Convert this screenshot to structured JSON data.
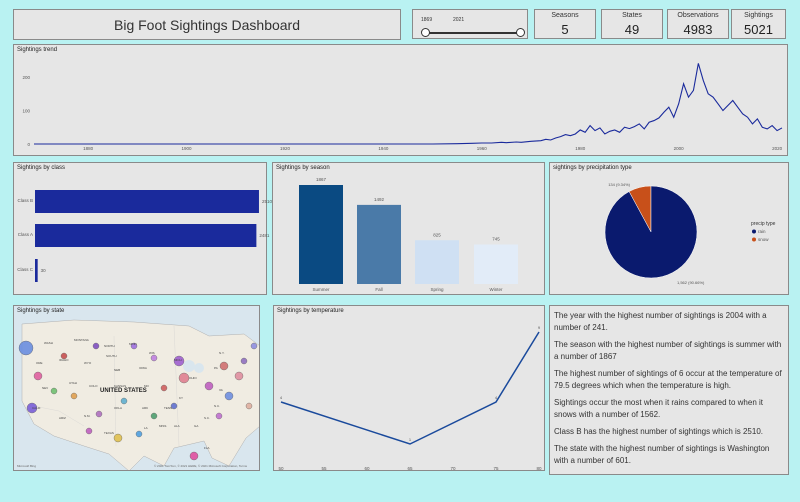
{
  "header": {
    "title": "Big Foot Sightings Dashboard"
  },
  "slider": {
    "from": "1869",
    "to": "2021"
  },
  "kpis": [
    {
      "label": "Seasons",
      "value": "5"
    },
    {
      "label": "States",
      "value": "49"
    },
    {
      "label": "Observations",
      "value": "4983"
    },
    {
      "label": "Sightings",
      "value": "5021"
    }
  ],
  "panels": {
    "trend": "Sightings trend",
    "class": "Sightings by class",
    "season": "Sightings by season",
    "precip": "sightings by precipitation type",
    "state": "Sightings by state",
    "temp": "Sightings by temperature"
  },
  "chart_data": [
    {
      "type": "line",
      "title": "Sightings trend",
      "x": [
        1869,
        1875,
        1880,
        1885,
        1890,
        1895,
        1900,
        1905,
        1910,
        1915,
        1920,
        1925,
        1930,
        1935,
        1940,
        1945,
        1950,
        1955,
        1958,
        1960,
        1962,
        1964,
        1965,
        1967,
        1968,
        1970,
        1972,
        1973,
        1974,
        1975,
        1976,
        1977,
        1978,
        1979,
        1980,
        1981,
        1982,
        1983,
        1984,
        1985,
        1986,
        1987,
        1988,
        1989,
        1990,
        1991,
        1992,
        1993,
        1994,
        1995,
        1996,
        1997,
        1998,
        1999,
        2000,
        2001,
        2002,
        2003,
        2004,
        2005,
        2006,
        2007,
        2008,
        2009,
        2010,
        2011,
        2012,
        2013,
        2014,
        2015,
        2016,
        2017,
        2018,
        2019,
        2020,
        2021
      ],
      "values": [
        0,
        0,
        0,
        0,
        0,
        0,
        0,
        0,
        0,
        0,
        0,
        0,
        0,
        0,
        0,
        0,
        0,
        1,
        2,
        3,
        3,
        5,
        4,
        6,
        5,
        8,
        10,
        14,
        12,
        18,
        22,
        28,
        25,
        30,
        42,
        35,
        55,
        40,
        48,
        30,
        38,
        42,
        35,
        50,
        46,
        52,
        60,
        45,
        65,
        70,
        78,
        95,
        110,
        80,
        120,
        180,
        140,
        160,
        241,
        190,
        150,
        140,
        120,
        100,
        115,
        130,
        110,
        90,
        80,
        60,
        75,
        50,
        45,
        55,
        40,
        48
      ],
      "xticks": [
        "1880",
        "1900",
        "1920",
        "1940",
        "1960",
        "1980",
        "2000",
        "2020"
      ],
      "yticks": [
        "0",
        "100",
        "200"
      ],
      "ylim": [
        0,
        260
      ]
    },
    {
      "type": "bar",
      "orientation": "horizontal",
      "title": "Sightings by class",
      "categories": [
        "Class B",
        "Class A",
        "Class C"
      ],
      "values": [
        2510,
        2481,
        30
      ],
      "color": "#1a2a9c"
    },
    {
      "type": "bar",
      "title": "Sightings by season",
      "categories": [
        "Summer",
        "Fall",
        "Spring",
        "Winter"
      ],
      "values": [
        1867,
        1492,
        825,
        745
      ],
      "colors": [
        "#0a4a82",
        "#4a7aa8",
        "#cfe0f3",
        "#e2ecf8"
      ]
    },
    {
      "type": "pie",
      "title": "sightings by precipitation type",
      "legend_title": "precip type",
      "categories": [
        "rain",
        "snow"
      ],
      "values": [
        1562,
        134
      ],
      "labels": [
        "1,562 (90.66%)",
        "134 (9.34%)"
      ],
      "colors": [
        "#0a1a6e",
        "#c8501a"
      ]
    },
    {
      "type": "line",
      "title": "Sightings by temperature",
      "x": [
        50,
        65,
        75,
        80
      ],
      "values": [
        4,
        1,
        4,
        9
      ],
      "xticks": [
        "50",
        "55",
        "60",
        "65",
        "70",
        "75",
        "80"
      ],
      "xlim": [
        50,
        80
      ],
      "ylim": [
        0,
        10
      ]
    }
  ],
  "map": {
    "country": "UNITED STATES",
    "credit": "Microsoft Bing",
    "copyright": "© 2021 TomTom, © 2021 HERE, © 2021 Microsoft Corporation, Terms",
    "labels": [
      "WASH",
      "MONTANA",
      "NORTH",
      "MINN",
      "WIS",
      "SOUTH",
      "ORE",
      "IDAHO",
      "WYO",
      "NEB",
      "IOWA",
      "NEV",
      "UTAH",
      "COLO",
      "KANSAS",
      "MO",
      "CALIF",
      "ARIZ",
      "N.M.",
      "OKLA",
      "ARK",
      "TEXAS",
      "LA",
      "MISS",
      "ALA",
      "GA",
      "FLA",
      "TENN",
      "KY",
      "OHIO",
      "MICH",
      "N.Y.",
      "PA",
      "VA",
      "N.C.",
      "S.C."
    ]
  },
  "insights": [
    "The year with the highest number of sightings is 2004 with a number of 241.",
    "The season with the highest number of sightings is summer with a number of 1867",
    "The highest number of sightings of 6 occur at the temperature of 79.5 degrees which when the temperature is high.",
    "Sightings occur the most when it rains compared to when it snows with a number of 1562.",
    "Class B has the highest number of sightings which is 2510.",
    "The state with the highest number of sightings is Washington with a number of 601."
  ]
}
